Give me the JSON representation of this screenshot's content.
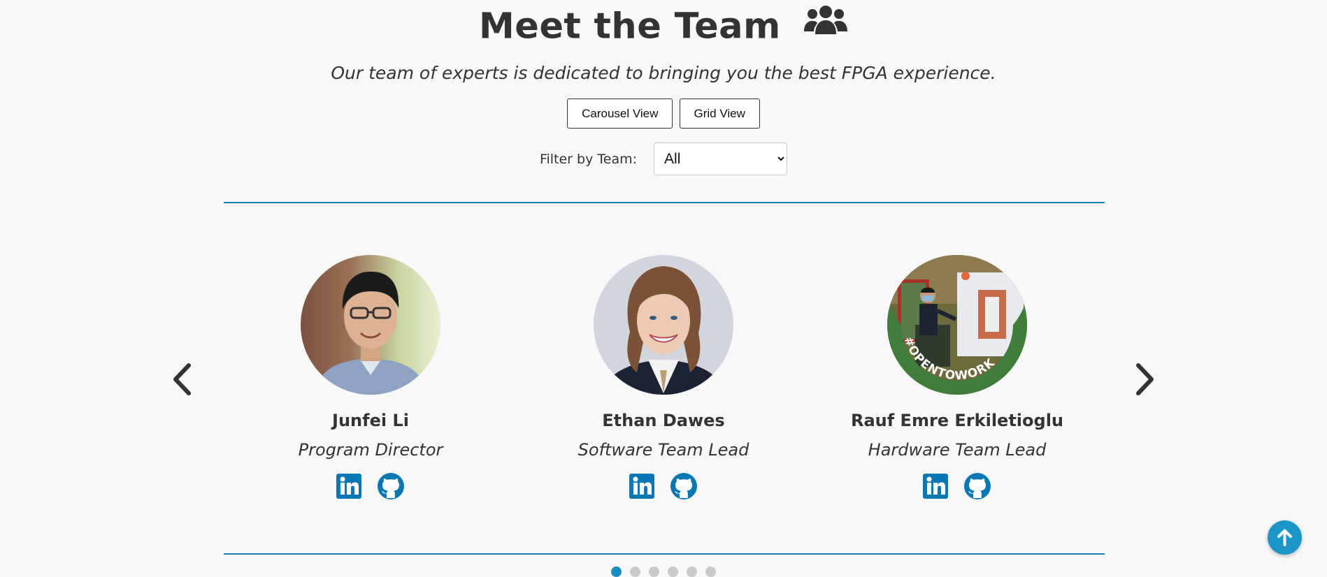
{
  "header": {
    "title": "Meet the Team",
    "title_icon": "users-icon",
    "subtitle": "Our team of experts is dedicated to bringing you the best FPGA experience."
  },
  "view_toggle": {
    "carousel_label": "Carousel View",
    "grid_label": "Grid View"
  },
  "filter": {
    "label": "Filter by Team:",
    "selected": "All"
  },
  "carousel": {
    "prev_icon": "chevron-left-icon",
    "next_icon": "chevron-right-icon",
    "members": [
      {
        "name": "Junfei Li",
        "role": "Program Director"
      },
      {
        "name": "Ethan Dawes",
        "role": "Software Team Lead"
      },
      {
        "name": "Rauf Emre Erkiletioglu",
        "role": "Hardware Team Lead",
        "badge": "#OPENTOWORK"
      }
    ],
    "page_count": 6,
    "active_page": 1
  },
  "scroll_top_icon": "arrow-up-icon",
  "colors": {
    "accent": "#1a7db5",
    "linkedin": "#0a77b5",
    "github": "#0a77b5",
    "opentowork": "#3f7d3a"
  }
}
